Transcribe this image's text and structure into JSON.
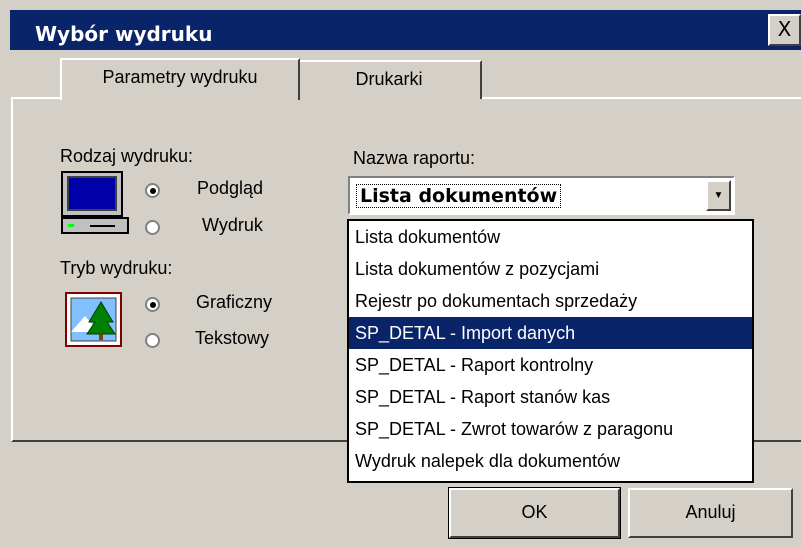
{
  "window": {
    "title": "Wybór wydruku",
    "close_glyph": "X"
  },
  "tabs": [
    {
      "label": "Parametry wydruku",
      "active": true
    },
    {
      "label": "Drukarki",
      "active": false
    }
  ],
  "print_type": {
    "label": "Rodzaj wydruku:",
    "options": [
      {
        "label": "Podgląd",
        "checked": true
      },
      {
        "label": "Wydruk",
        "checked": false
      }
    ],
    "icon": "computer-monitor-icon"
  },
  "print_mode": {
    "label": "Tryb wydruku:",
    "options": [
      {
        "label": "Graficzny",
        "checked": true
      },
      {
        "label": "Tekstowy",
        "checked": false
      }
    ],
    "icon": "tree-picture-icon"
  },
  "report": {
    "label": "Nazwa raportu:",
    "selected": "Lista dokumentów",
    "options": [
      "Lista dokumentów",
      "Lista dokumentów z pozycjami",
      "Rejestr po dokumentach sprzedaży",
      "SP_DETAL - Import danych",
      "SP_DETAL - Raport kontrolny",
      "SP_DETAL - Raport stanów kas",
      "SP_DETAL - Zwrot towarów z paragonu",
      "Wydruk nalepek dla dokumentów"
    ],
    "highlighted_index": 3
  },
  "buttons": {
    "ok": "OK",
    "cancel": "Anuluj"
  },
  "colors": {
    "title_bar": "#0a246a",
    "face": "#d4d0c8",
    "highlight": "#0a246a"
  }
}
